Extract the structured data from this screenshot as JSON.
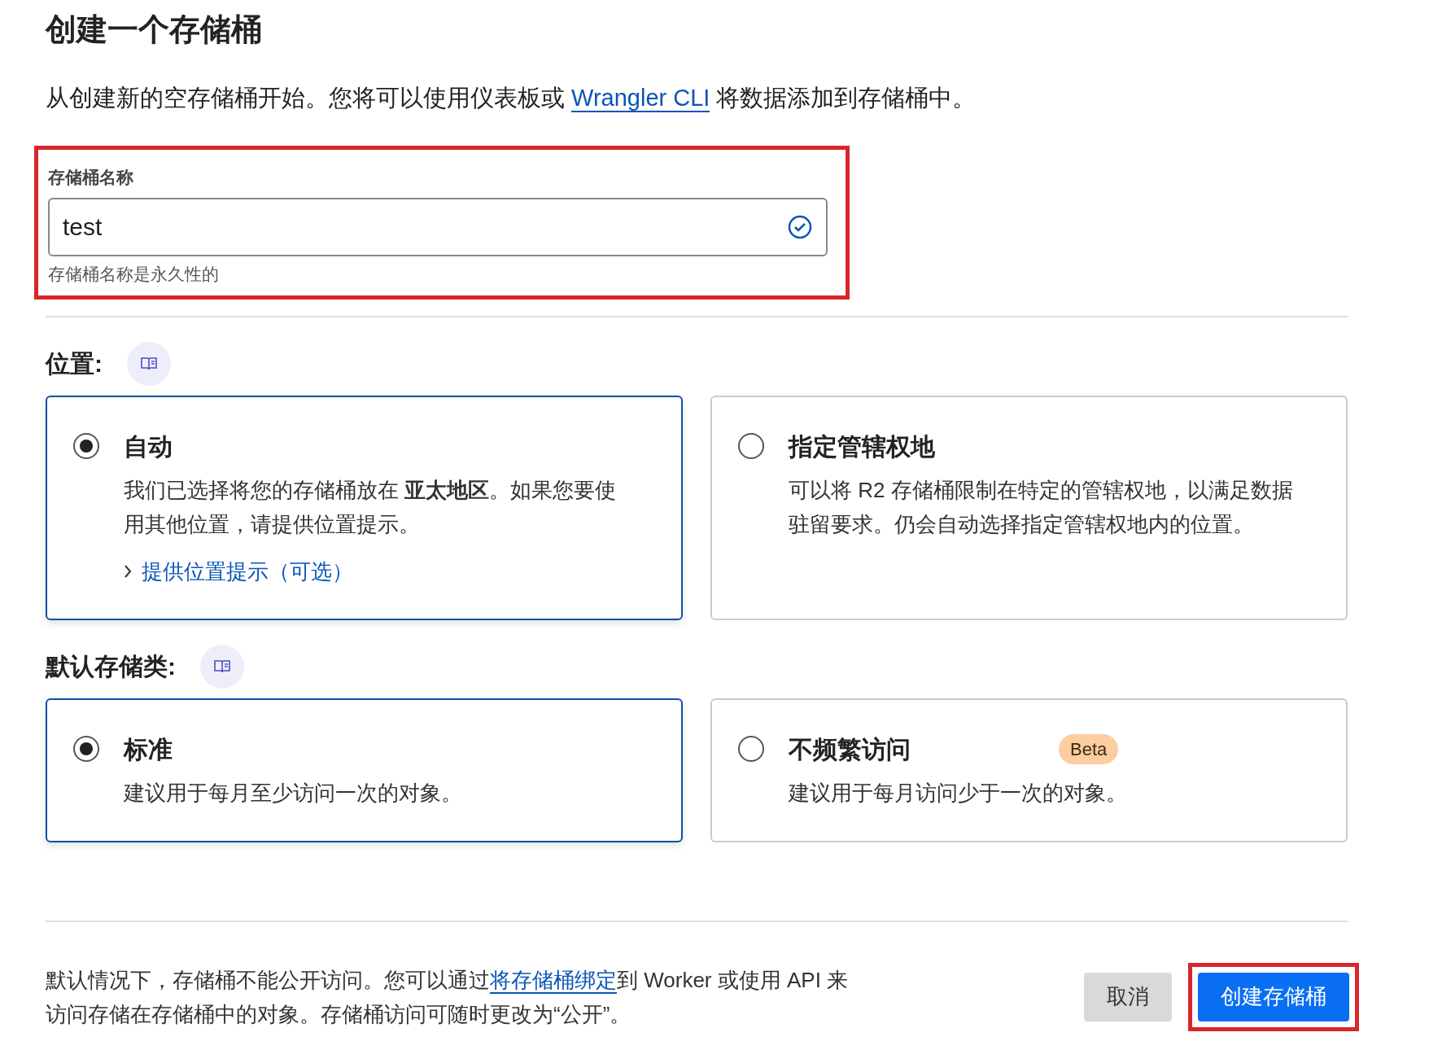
{
  "title": "创建一个存储桶",
  "intro": {
    "before": "从创建新的空存储桶开始。您将可以使用仪表板或 ",
    "link": "Wrangler CLI",
    "after": " 将数据添加到存储桶中。"
  },
  "name_field": {
    "label": "存储桶名称",
    "value": "test",
    "valid": true,
    "hint": "存储桶名称是永久性的",
    "highlighted": true
  },
  "location": {
    "label": "位置:",
    "options": [
      {
        "title": "自动",
        "description": "我们已选择将您的存储桶放在 **亚太地区**。如果您要使用其他位置，请提供位置提示。",
        "link": "提供位置提示（可选）",
        "selected": true
      },
      {
        "title": "指定管辖权地",
        "description": "可以将 R2 存储桶限制在特定的管辖权地，以满足数据驻留要求。仍会自动选择指定管辖权地内的位置。",
        "selected": false
      }
    ]
  },
  "storage_class": {
    "label": "默认存储类:",
    "options": [
      {
        "title": "标准",
        "description": "建议用于每月至少访问一次的对象。",
        "selected": true
      },
      {
        "title": "不频繁访问",
        "badge": "Beta",
        "description": "建议用于每月访问少于一次的对象。",
        "selected": false
      }
    ]
  },
  "footer": {
    "before": "默认情况下，存储桶不能公开访问。您可以通过",
    "link": "将存储桶绑定",
    "after": "到 Worker 或使用 API 来访问存储在存储桶中的对象。存储桶访问可随时更改为“公开”。"
  },
  "buttons": [
    {
      "label": "取消",
      "kind": "secondary",
      "highlighted": false
    },
    {
      "label": "创建存储桶",
      "kind": "primary",
      "highlighted": true
    }
  ]
}
